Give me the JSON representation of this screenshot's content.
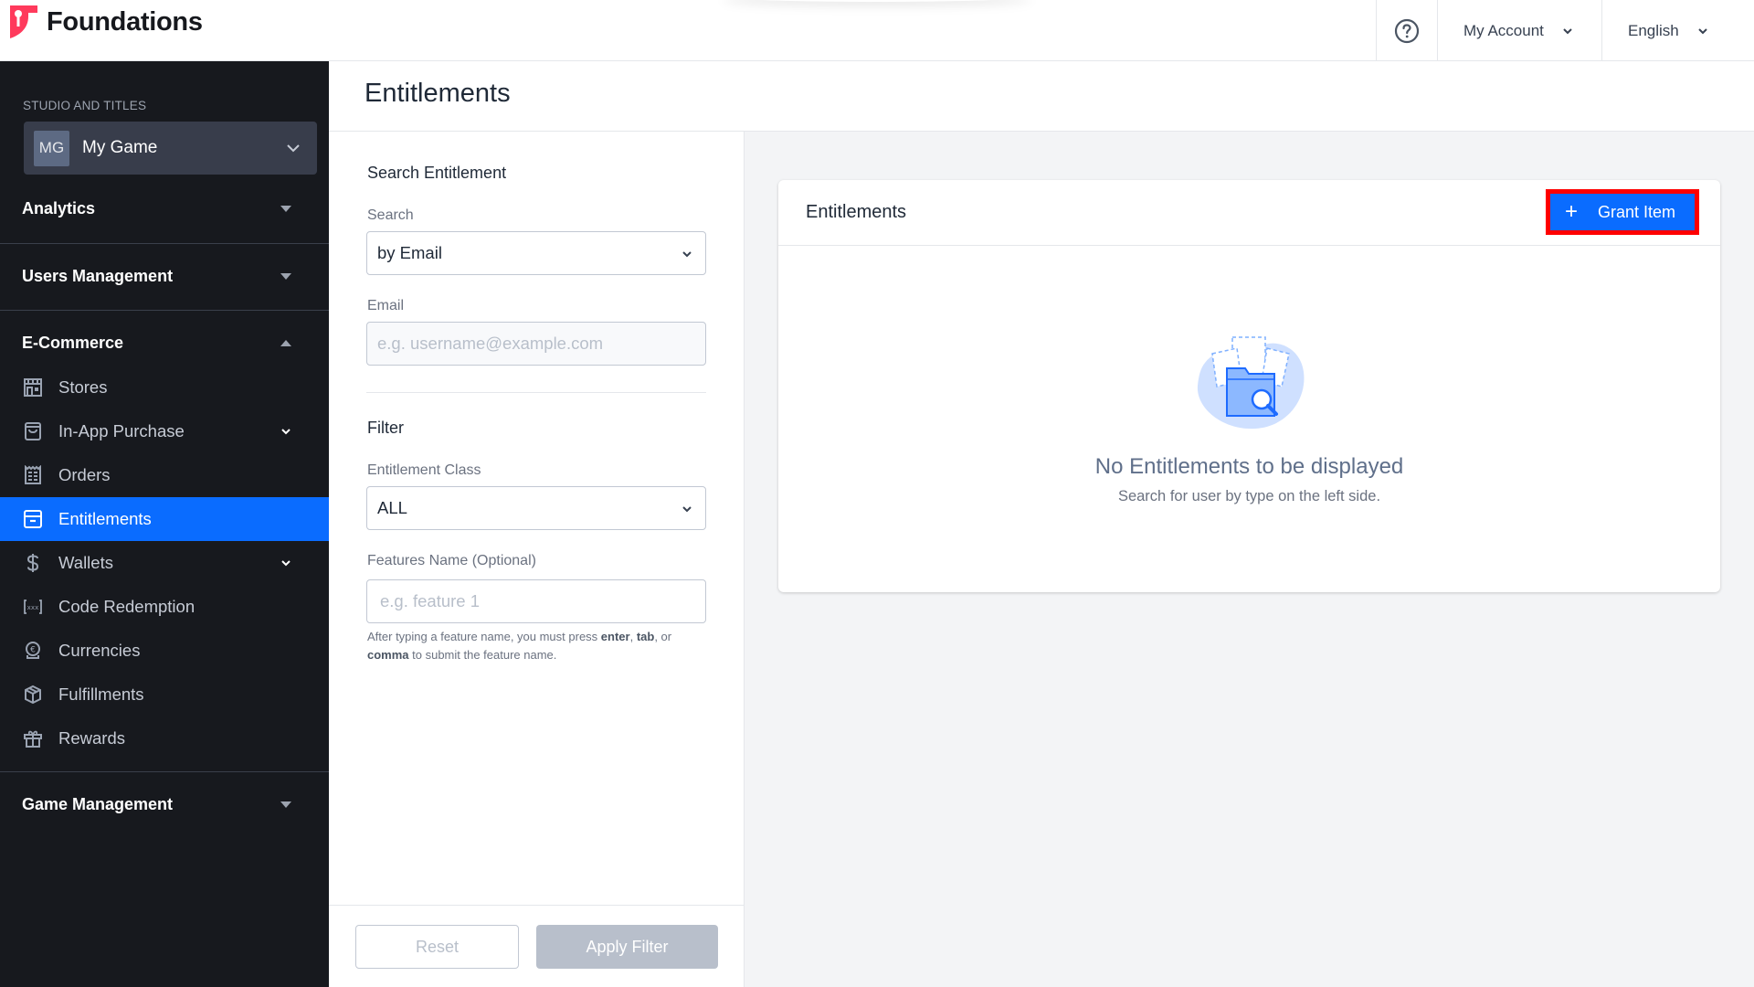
{
  "app": {
    "brand": "Foundations",
    "brand_color": "#ff3a5c"
  },
  "topbar": {
    "help_icon": "question-circle-icon",
    "account_label": "My Account",
    "language_label": "English"
  },
  "sidebar": {
    "studio_label": "STUDIO AND TITLES",
    "studio": {
      "initials": "MG",
      "name": "My Game"
    },
    "sections": [
      {
        "label": "Analytics",
        "expanded": false
      },
      {
        "label": "Users Management",
        "expanded": false
      },
      {
        "label": "E-Commerce",
        "expanded": true
      },
      {
        "label": "Game Management",
        "expanded": false
      }
    ],
    "ecommerce_items": [
      {
        "label": "Stores",
        "icon": "store-icon",
        "has_children": false,
        "active": false
      },
      {
        "label": "In-App Purchase",
        "icon": "shopping-bag-icon",
        "has_children": true,
        "active": false
      },
      {
        "label": "Orders",
        "icon": "receipt-icon",
        "has_children": false,
        "active": false
      },
      {
        "label": "Entitlements",
        "icon": "archive-box-icon",
        "has_children": false,
        "active": true
      },
      {
        "label": "Wallets",
        "icon": "dollar-icon",
        "has_children": true,
        "active": false
      },
      {
        "label": "Code Redemption",
        "icon": "code-brackets-icon",
        "has_children": false,
        "active": false
      },
      {
        "label": "Currencies",
        "icon": "currency-icon",
        "has_children": false,
        "active": false
      },
      {
        "label": "Fulfillments",
        "icon": "package-icon",
        "has_children": false,
        "active": false
      },
      {
        "label": "Rewards",
        "icon": "gift-icon",
        "has_children": false,
        "active": false
      }
    ],
    "active_color": "#0a6cff"
  },
  "page": {
    "title": "Entitlements"
  },
  "filter_panel": {
    "search_heading": "Search Entitlement",
    "search_label": "Search",
    "search_by_value": "by Email",
    "email_label": "Email",
    "email_value": "",
    "email_placeholder": "e.g. username@example.com",
    "filter_heading": "Filter",
    "class_label": "Entitlement Class",
    "class_value": "ALL",
    "features_label": "Features Name (Optional)",
    "features_value": "",
    "features_placeholder": "e.g. feature 1",
    "hint_parts": {
      "pre": "After typing a feature name, you must press ",
      "k1": "enter",
      "sep1": ", ",
      "k2": "tab",
      "sep2": ", or ",
      "k3": "comma",
      "post": " to submit the feature name."
    },
    "reset_label": "Reset",
    "apply_label": "Apply Filter"
  },
  "card": {
    "title": "Entitlements",
    "grant_label": "Grant Item",
    "grant_icon": "plus-icon",
    "empty_title": "No Entitlements to be displayed",
    "empty_subtitle": "Search for user by type on the left side."
  }
}
